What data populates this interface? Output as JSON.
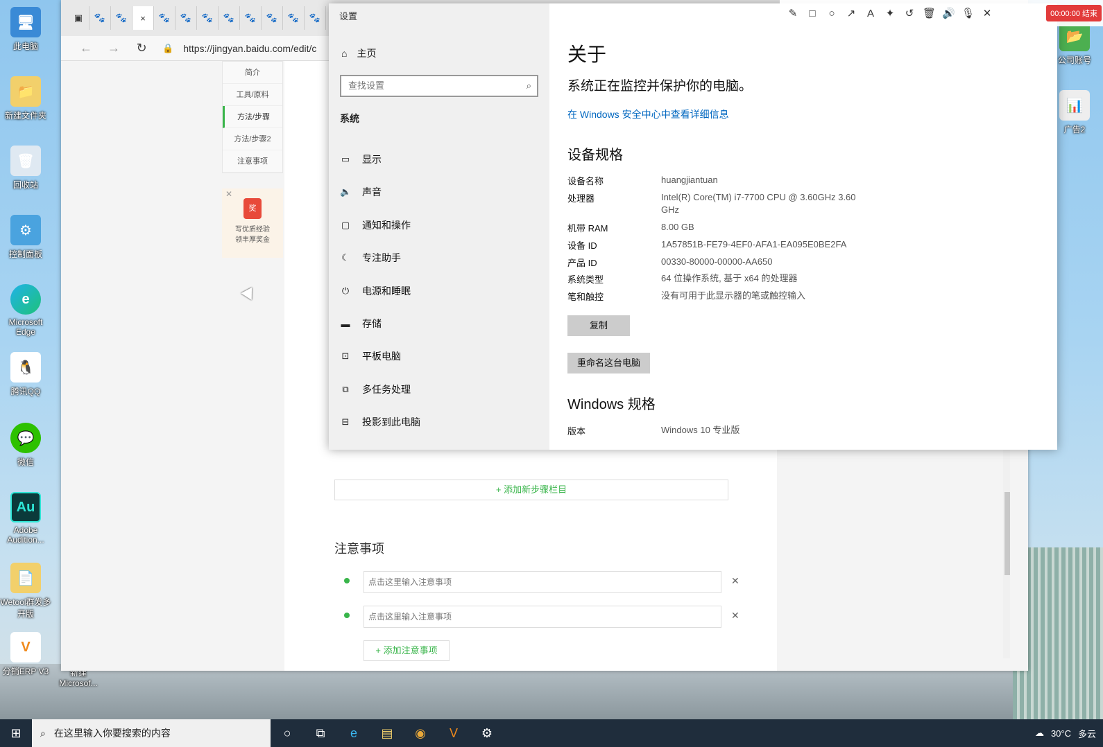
{
  "desktop": {
    "icons": [
      {
        "label": "此电脑",
        "glyph": "🖥"
      },
      {
        "label": "新建文件夹",
        "glyph": "📁"
      },
      {
        "label": "回收站",
        "glyph": "🗑"
      },
      {
        "label": "控制面板",
        "glyph": "⚙"
      },
      {
        "label": "Microsoft Edge",
        "glyph": "e"
      },
      {
        "label": "腾讯QQ",
        "glyph": "🐧"
      },
      {
        "label": "微信",
        "glyph": "💬"
      },
      {
        "label": "Adobe Audition...",
        "glyph": "Au"
      },
      {
        "label": "Wetool群发多开版",
        "glyph": "📄"
      },
      {
        "label": "分销ERP V3",
        "glyph": "V"
      }
    ],
    "extra_icon": "新建 Microsof...",
    "right_icons": [
      {
        "label": "公司账号",
        "glyph": "📂"
      },
      {
        "label": "广告2",
        "glyph": "📊"
      }
    ]
  },
  "browser": {
    "url": "https://jingyan.baidu.com/edit/c",
    "tab_close": "×",
    "side_nav": [
      "简介",
      "工具/原料",
      "方法/步骤",
      "方法/步骤2",
      "注意事项"
    ],
    "ad": {
      "badge": "奖",
      "line1": "写优质经验",
      "line2": "领丰厚奖金"
    },
    "add_step": "+ 添加新步骤栏目",
    "notes_title": "注意事项",
    "note_placeholder": "点击这里输入注意事项",
    "add_note": "+ 添加注意事项"
  },
  "settings": {
    "window_title": "设置",
    "home": "主页",
    "search_placeholder": "查找设置",
    "system_heading": "系统",
    "menu": [
      {
        "label": "显示",
        "icon": "▭"
      },
      {
        "label": "声音",
        "icon": "🔈"
      },
      {
        "label": "通知和操作",
        "icon": "▢"
      },
      {
        "label": "专注助手",
        "icon": "☾"
      },
      {
        "label": "电源和睡眠",
        "icon": "⏻"
      },
      {
        "label": "存储",
        "icon": "▬"
      },
      {
        "label": "平板电脑",
        "icon": "⊡"
      },
      {
        "label": "多任务处理",
        "icon": "⧉"
      },
      {
        "label": "投影到此电脑",
        "icon": "⊟"
      }
    ],
    "about_title": "关于",
    "protect_text": "系统正在监控并保护你的电脑。",
    "security_link": "在 Windows 安全中心中查看详细信息",
    "device_spec_heading": "设备规格",
    "specs": [
      {
        "k": "设备名称",
        "v": "huangjiantuan"
      },
      {
        "k": "处理器",
        "v": "Intel(R) Core(TM) i7-7700 CPU @ 3.60GHz   3.60 GHz"
      },
      {
        "k": "机带 RAM",
        "v": "8.00 GB"
      },
      {
        "k": "设备 ID",
        "v": "1A57851B-FE79-4EF0-AFA1-EA095E0BE2FA"
      },
      {
        "k": "产品 ID",
        "v": "00330-80000-00000-AA650"
      },
      {
        "k": "系统类型",
        "v": "64 位操作系统, 基于 x64 的处理器"
      },
      {
        "k": "笔和触控",
        "v": "没有可用于此显示器的笔或触控输入"
      }
    ],
    "copy_button": "复制",
    "rename_button": "重命名这台电脑",
    "windows_spec_heading": "Windows 规格",
    "windows_specs": [
      {
        "k": "版本",
        "v": "Windows 10 专业版"
      }
    ]
  },
  "recorder": {
    "timer": "00:00:00 结束"
  },
  "taskbar": {
    "search_placeholder": "在这里输入你要搜索的内容",
    "weather": "30°C",
    "weather_desc": "多云"
  }
}
